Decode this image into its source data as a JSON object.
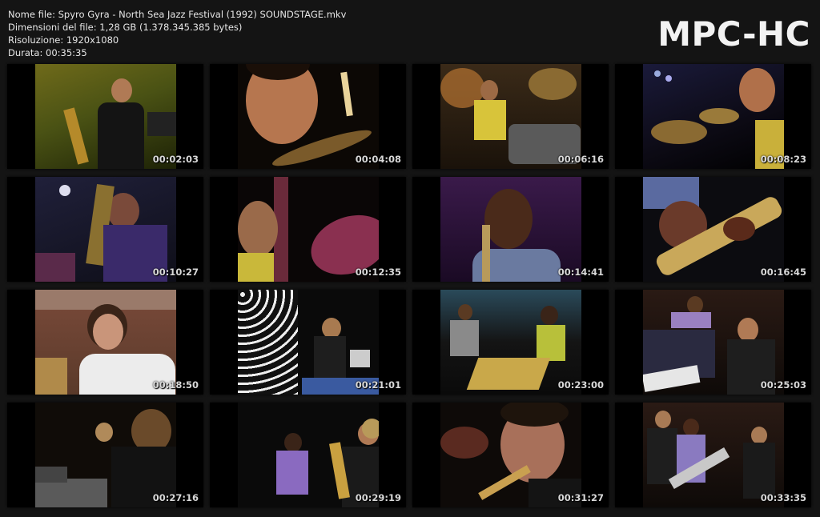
{
  "info": {
    "file_name": "Nome file: Spyro Gyra - North Sea Jazz Festival (1992) SOUNDSTAGE.mkv",
    "file_size": "Dimensioni del file: 1,28 GB (1.378.345.385 bytes)",
    "resolution": "Risoluzione: 1920x1080",
    "duration": "Durata: 00:35:35"
  },
  "logo": "MPC-HC",
  "thumbnails": [
    {
      "time": "00:02:03"
    },
    {
      "time": "00:04:08"
    },
    {
      "time": "00:06:16"
    },
    {
      "time": "00:08:23"
    },
    {
      "time": "00:10:27"
    },
    {
      "time": "00:12:35"
    },
    {
      "time": "00:14:41"
    },
    {
      "time": "00:16:45"
    },
    {
      "time": "00:18:50"
    },
    {
      "time": "00:21:01"
    },
    {
      "time": "00:23:00"
    },
    {
      "time": "00:25:03"
    },
    {
      "time": "00:27:16"
    },
    {
      "time": "00:29:19"
    },
    {
      "time": "00:31:27"
    },
    {
      "time": "00:33:35"
    }
  ]
}
